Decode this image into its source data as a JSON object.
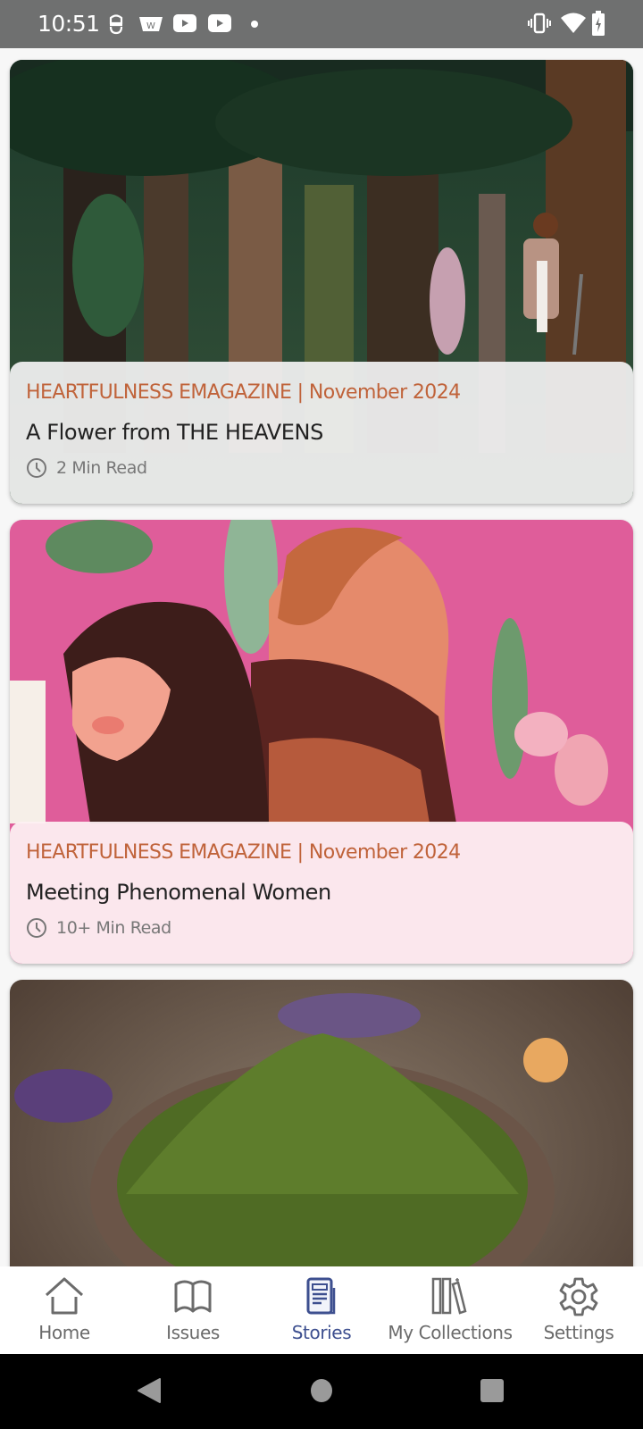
{
  "status_bar": {
    "time": "10:51",
    "left_icons": [
      "notification-app-icon",
      "app-w-icon",
      "youtube-icon",
      "youtube-icon",
      "dot-icon"
    ],
    "right_icons": [
      "vibrate-icon",
      "wifi-icon",
      "battery-charging-icon"
    ]
  },
  "stories": [
    {
      "source": "HEARTFULNESS EMAGAZINE | November 2024",
      "title": "A Flower from THE HEAVENS",
      "read_time": "2 Min Read",
      "image": "forest-illustration-man-walking",
      "info_bg": "rgba(240,240,240,0.93)"
    },
    {
      "source": "HEARTFULNESS EMAGAZINE | November 2024",
      "title": "Meeting Phenomenal Women",
      "read_time": "10+ Min Read",
      "image": "women-profiles-illustration-pink",
      "info_bg": "rgba(253,240,242,0.93)"
    },
    {
      "source": "",
      "title": "",
      "read_time": "",
      "image": "green-powder-bowl-photo"
    }
  ],
  "bottom_nav": {
    "items": [
      {
        "label": "Home",
        "icon": "home-icon",
        "active": false
      },
      {
        "label": "Issues",
        "icon": "book-open-icon",
        "active": false
      },
      {
        "label": "Stories",
        "icon": "stories-document-icon",
        "active": true
      },
      {
        "label": "My Collections",
        "icon": "collections-icon",
        "active": false
      },
      {
        "label": "Settings",
        "icon": "gear-icon",
        "active": false
      }
    ],
    "active_color": "#3d4f8f",
    "inactive_color": "#6b6b6b"
  },
  "accent_color": "#c0633a"
}
